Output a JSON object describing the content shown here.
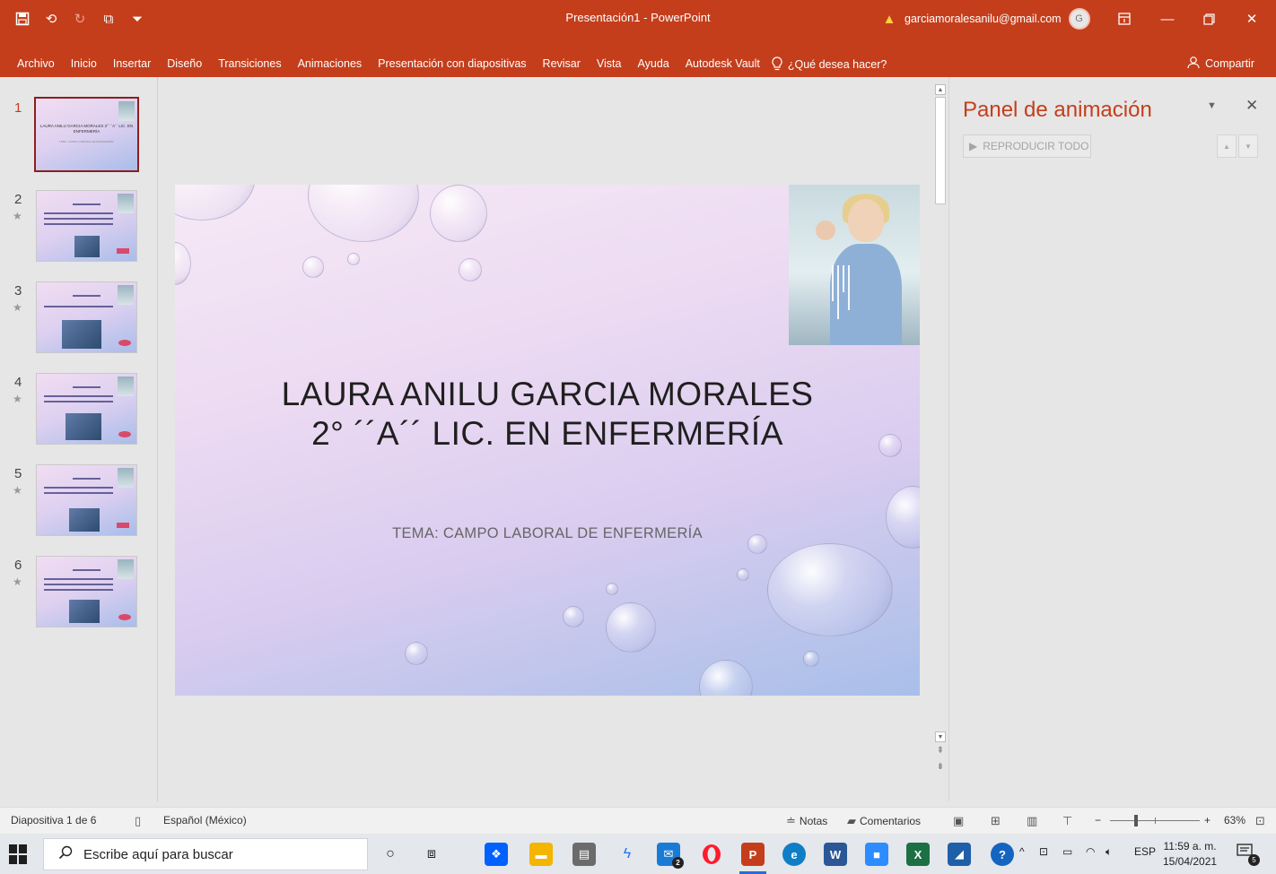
{
  "app": {
    "window_title": "Presentación1 - PowerPoint",
    "account_email": "garciamoralesanilu@gmail.com",
    "avatar_initial": "G",
    "accent_color": "#c43e1c"
  },
  "quick_access": {
    "icons": [
      "save-icon",
      "undo-icon",
      "redo-icon",
      "present-icon",
      "customize-icon"
    ]
  },
  "ribbon": {
    "tabs": [
      "Archivo",
      "Inicio",
      "Insertar",
      "Diseño",
      "Transiciones",
      "Animaciones",
      "Presentación con diapositivas",
      "Revisar",
      "Vista",
      "Ayuda",
      "Autodesk Vault"
    ],
    "tell_me": "¿Qué desea hacer?",
    "share": "Compartir"
  },
  "thumbnails": [
    {
      "number": "1",
      "title": "LAURA ANILU GARCIA MORALES 2° ´´A´´ LIC. EN ENFERMERÍA",
      "active": true
    },
    {
      "number": "2",
      "star": "★"
    },
    {
      "number": "3",
      "star": "★"
    },
    {
      "number": "4",
      "star": "★"
    },
    {
      "number": "5",
      "star": "★"
    },
    {
      "number": "6",
      "star": "★"
    }
  ],
  "slide": {
    "title_line1": "LAURA ANILU GARCIA MORALES",
    "title_line2": "2° ´´A´´ LIC. EN ENFERMERÍA",
    "subtitle": "TEMA: CAMPO LABORAL DE ENFERMERÍA"
  },
  "animation_panel": {
    "title": "Panel de animación",
    "play_all": "REPRODUCIR TODO"
  },
  "status_bar": {
    "slide_info": "Diapositiva 1 de 6",
    "language": "Español (México)",
    "notes": "Notas",
    "comments": "Comentarios",
    "zoom": "63%"
  },
  "taskbar": {
    "search_placeholder": "Escribe aquí para buscar",
    "mail_badge": "2",
    "language": "ESP",
    "time": "11:59 a. m.",
    "date": "15/04/2021",
    "notification_count": "5"
  }
}
